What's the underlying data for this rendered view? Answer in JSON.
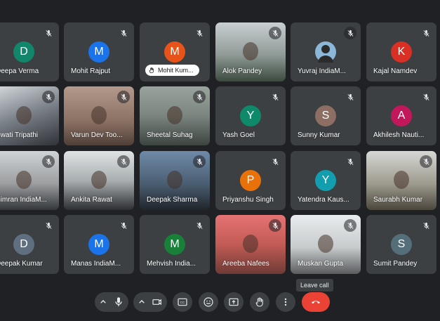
{
  "tiles": [
    {
      "name": "Deepa Verma",
      "initial": "D",
      "color": "#12866b",
      "type": "avatar"
    },
    {
      "name": "Mohit Rajput",
      "initial": "M",
      "color": "#1a73e8",
      "type": "avatar"
    },
    {
      "name": "Mohit Kum...",
      "initial": "M",
      "color": "#e8531a",
      "type": "avatar",
      "raised_hand": true
    },
    {
      "name": "Alok Pandey",
      "type": "video",
      "bg": "linear-gradient(180deg,#c9cfd2 0%,#8f9a96 55%,#3b4a3e 100%)"
    },
    {
      "name": "Yuvraj IndiaM...",
      "type": "photo",
      "photo_bg": "#8bb7d9"
    },
    {
      "name": "Kajal Namdev",
      "initial": "K",
      "color": "#d93025",
      "type": "avatar"
    },
    {
      "name": "Swati Tripathi",
      "type": "video",
      "bg": "linear-gradient(160deg,#d9dde1 0%,#7a8088 50%,#2f3237 100%)"
    },
    {
      "name": "Varun Dev Too...",
      "type": "video",
      "bg": "linear-gradient(180deg,#b49a8d 0%,#8a7063 60%,#4f3f38 100%)"
    },
    {
      "name": "Sheetal Suhag",
      "type": "video",
      "bg": "linear-gradient(180deg,#9aa39d 0%,#7b8580 50%,#3c4440 100%)"
    },
    {
      "name": "Yash Goel",
      "initial": "Y",
      "color": "#0e8a6a",
      "type": "avatar"
    },
    {
      "name": "Sunny Kumar",
      "initial": "S",
      "color": "#8d6e63",
      "type": "avatar"
    },
    {
      "name": "Akhilesh Nauti...",
      "initial": "A",
      "color": "#c2185b",
      "type": "avatar"
    },
    {
      "name": "Simran IndiaM...",
      "type": "video",
      "bg": "linear-gradient(180deg,#d0d4d6 0%,#9c9ea0 55%,#33363a 100%)"
    },
    {
      "name": "Ankita Rawat",
      "type": "video",
      "bg": "linear-gradient(180deg,#dfe3e4 0%,#a9aeb0 50%,#2c2e31 100%)"
    },
    {
      "name": "Deepak Sharma",
      "type": "video",
      "bg": "linear-gradient(180deg,#6f8aa8 0%,#4b5f73 55%,#20252b 100%)"
    },
    {
      "name": "Priyanshu Singh",
      "initial": "P",
      "color": "#e8710a",
      "type": "avatar"
    },
    {
      "name": "Yatendra Kaus...",
      "initial": "Y",
      "color": "#129eaf",
      "type": "avatar"
    },
    {
      "name": "Saurabh Kumar",
      "type": "video",
      "bg": "linear-gradient(180deg,#d6d8d4 0%,#9e9b8f 55%,#4a463c 100%)"
    },
    {
      "name": "Deepak Kumar",
      "initial": "D",
      "color": "#5f6f80",
      "type": "avatar"
    },
    {
      "name": "Manas IndiaM...",
      "initial": "M",
      "color": "#1a73e8",
      "type": "avatar"
    },
    {
      "name": "Mehvish India...",
      "initial": "M",
      "color": "#188038",
      "type": "avatar"
    },
    {
      "name": "Areeba Nafees",
      "type": "video",
      "bg": "linear-gradient(180deg,#e57373 0%,#c25b55 50%,#6e3b36 100%)"
    },
    {
      "name": "Muskan Gupta",
      "type": "video",
      "bg": "linear-gradient(180deg,#e9ecee 0%,#c7cbcc 55%,#5a5c5e 100%)"
    },
    {
      "name": "Sumit Pandey",
      "initial": "S",
      "color": "#546e7a",
      "type": "avatar"
    }
  ],
  "controls": {
    "leave_tooltip": "Leave call"
  }
}
